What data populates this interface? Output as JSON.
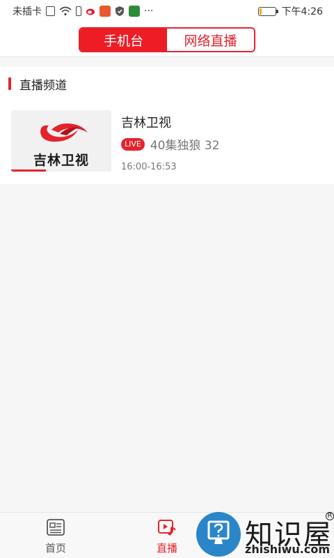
{
  "status_bar": {
    "carrier": "未插卡",
    "more": "···",
    "time": "下午4:26",
    "battery_level": 0.12
  },
  "header": {
    "tabs": [
      {
        "label": "手机台",
        "active": true
      },
      {
        "label": "网络直播",
        "active": false
      }
    ]
  },
  "section": {
    "title": "直播频道",
    "channels": [
      {
        "logo_text": "吉林卫视",
        "name": "吉林卫视",
        "badge": "LIVE",
        "program": "40集独狼 32",
        "time": "16:00-16:53",
        "progress": 0.35
      }
    ]
  },
  "tabbar": {
    "tabs": [
      {
        "label": "首页",
        "icon": "news-icon",
        "active": false
      },
      {
        "label": "直播",
        "icon": "live-video-icon",
        "active": true
      },
      {
        "label": "",
        "icon": "",
        "active": false
      }
    ]
  },
  "watermark": {
    "brand": "知识屋",
    "domain": "zhishiwu.com",
    "reg_mark": "R"
  },
  "colors": {
    "accent": "#e4232d",
    "accent_fill": "#ee1c25",
    "battery": "#f5a623",
    "watermark_blue": "#2a86c8"
  }
}
